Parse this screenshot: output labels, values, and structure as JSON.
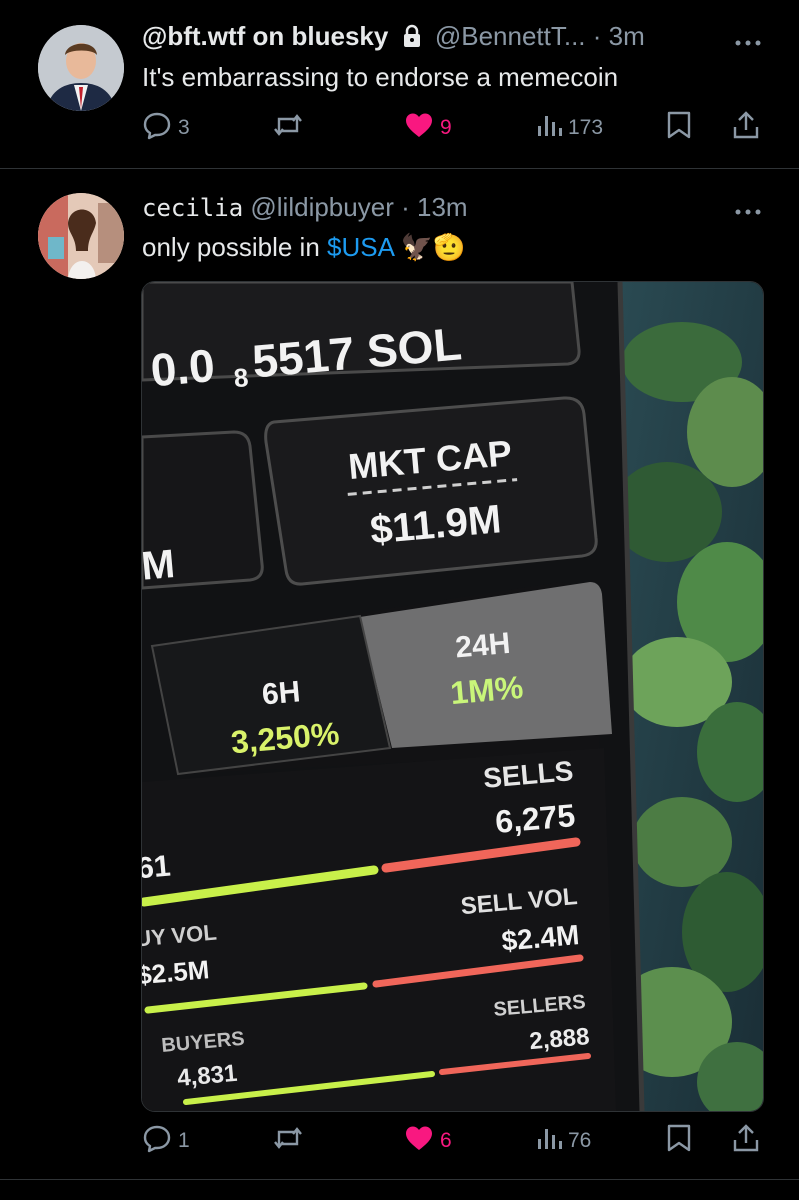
{
  "posts": [
    {
      "display_name": "@bft.wtf on bluesky",
      "handle": "@BennettT...",
      "separator": "·",
      "time": "3m",
      "text": "It's embarrassing to endorse a memecoin",
      "replies": "3",
      "likes": "9",
      "views": "173",
      "liked": true
    },
    {
      "display_name": "cecilia",
      "handle": "@lildipbuyer",
      "separator": "·",
      "time": "13m",
      "text_prefix": "only possible in ",
      "cashtag": "$USA",
      "emoji_text": "🦅🫡",
      "replies": "1",
      "likes": "6",
      "views": "76",
      "liked": true,
      "media": {
        "price": "0.0₈5517 SOL",
        "price_main": "0.0",
        "price_sub": "8",
        "price_rest": "5517 SOL",
        "mkt_cap_label": "MKT CAP",
        "mkt_cap_value": "$11.9M",
        "left_partial": "M",
        "tab_6h_label": "6H",
        "tab_6h_value": "3,250%",
        "tab_24h_label": "24H",
        "tab_24h_value": "1M%",
        "sells_label": "SELLS",
        "sells_value": "6,275",
        "buys_partial": "61",
        "buy_vol_label": "UY VOL",
        "buy_vol_value": "$2.5M",
        "sell_vol_label": "SELL VOL",
        "sell_vol_value": "$2.4M",
        "buyers_label": "BUYERS",
        "buyers_value": "4,831",
        "sellers_label": "SELLERS",
        "sellers_value": "2,888"
      }
    }
  ],
  "icons": {
    "reply": "reply-icon",
    "repost": "repost-icon",
    "like": "heart-icon",
    "views": "views-icon",
    "bookmark": "bookmark-icon",
    "share": "share-icon",
    "more": "more-icon",
    "lock": "lock-icon"
  },
  "colors": {
    "background": "#000000",
    "text": "#e7e9ea",
    "muted": "#8b98a5",
    "like": "#f91880",
    "link": "#1d9bf0",
    "green_bar": "#c8f04a",
    "red_bar": "#f0665a"
  }
}
